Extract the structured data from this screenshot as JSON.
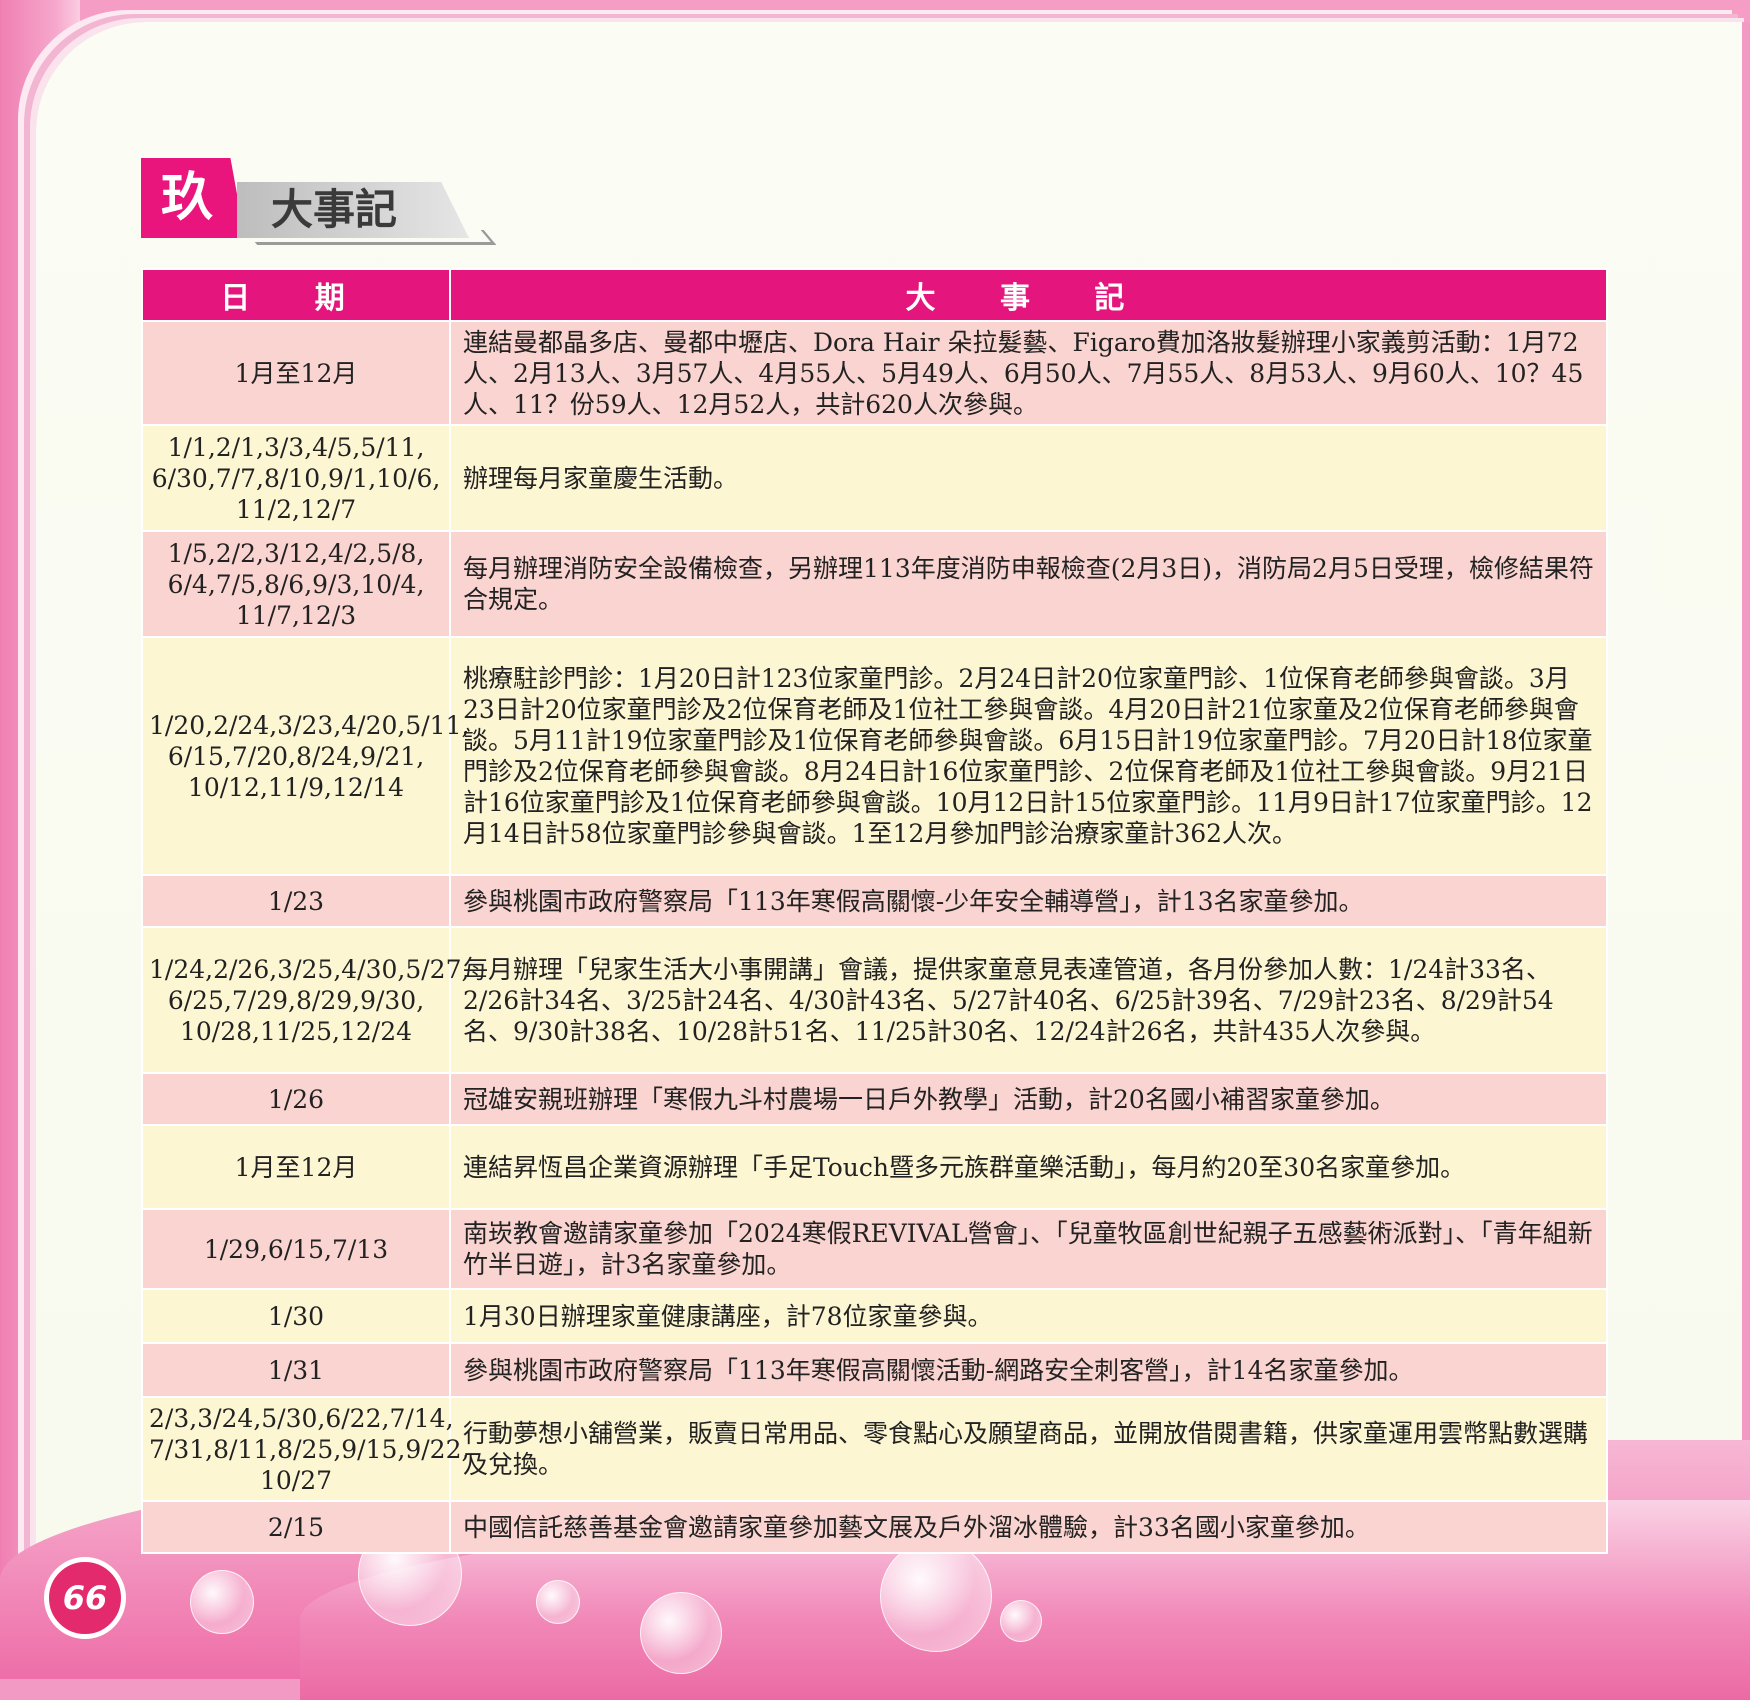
{
  "page_number": "66",
  "section": {
    "number": "玖",
    "title": "大事記"
  },
  "table": {
    "headers": [
      "日 期",
      "大 事 記"
    ],
    "rows": [
      {
        "date": "1月至12月",
        "event": "連結曼都晶多店、曼都中壢店、Dora Hair 朵拉髮藝、Figaro費加洛妝髮辦理小家義剪活動：1月72人、2月13人、3月57人、4月55人、5月49人、6月50人、7月55人、8月53人、9月60人、10？45人、11？份59人、12月52人，共計620人次參與。"
      },
      {
        "date": "1/1,2/1,3/3,4/5,5/11,\n6/30,7/7,8/10,9/1,10/6,\n11/2,12/7",
        "event": "辦理每月家童慶生活動。"
      },
      {
        "date": "1/5,2/2,3/12,4/2,5/8,\n6/4,7/5,8/6,9/3,10/4,\n11/7,12/3",
        "event": "每月辦理消防安全設備檢查，另辦理113年度消防申報檢查(2月3日)，消防局2月5日受理，檢修結果符合規定。"
      },
      {
        "date": "1/20,2/24,3/23,4/20,5/11,\n6/15,7/20,8/24,9/21,\n10/12,11/9,12/14",
        "event": "桃療駐診門診：1月20日計123位家童門診。2月24日計20位家童門診、1位保育老師參與會談。3月23日計20位家童門診及2位保育老師及1位社工參與會談。4月20日計21位家童及2位保育老師參與會談。5月11計19位家童門診及1位保育老師參與會談。6月15日計19位家童門診。7月20日計18位家童門診及2位保育老師參與會談。8月24日計16位家童門診、2位保育老師及1位社工參與會談。9月21日計16位家童門診及1位保育老師參與會談。10月12日計15位家童門診。11月9日計17位家童門診。12月14日計58位家童門診參與會談。1至12月參加門診治療家童計362人次。"
      },
      {
        "date": "1/23",
        "event": "參與桃園市政府警察局「113年寒假高關懷-少年安全輔導營」，計13名家童參加。"
      },
      {
        "date": "1/24,2/26,3/25,4/30,5/27,\n6/25,7/29,8/29,9/30,\n10/28,11/25,12/24",
        "event": "每月辦理「兒家生活大小事開講」會議，提供家童意見表達管道，各月份參加人數：1/24計33名、2/26計34名、3/25計24名、4/30計43名、5/27計40名、6/25計39名、7/29計23名、8/29計54名、9/30計38名、10/28計51名、11/25計30名、12/24計26名，共計435人次參與。"
      },
      {
        "date": "1/26",
        "event": "冠雄安親班辦理「寒假九斗村農場一日戶外教學」活動，計20名國小補習家童參加。"
      },
      {
        "date": "1月至12月",
        "event": "連結昇恆昌企業資源辦理「手足Touch暨多元族群童樂活動」，每月約20至30名家童參加。"
      },
      {
        "date": "1/29,6/15,7/13",
        "event": "南崁教會邀請家童參加「2024寒假REVIVAL營會」、「兒童牧區創世紀親子五感藝術派對」、「青年組新竹半日遊」，計3名家童參加。"
      },
      {
        "date": "1/30",
        "event": "1月30日辦理家童健康講座，計78位家童參與。"
      },
      {
        "date": "1/31",
        "event": "參與桃園市政府警察局「113年寒假高關懷活動-網路安全刺客營」，計14名家童參加。"
      },
      {
        "date": "2/3,3/24,5/30,6/22,7/14,\n7/31,8/11,8/25,9/15,9/22,\n10/27",
        "event": "行動夢想小舖營業，販賣日常用品、零食點心及願望商品，並開放借閱書籍，供家童運用雲幣點數選購及兌換。"
      },
      {
        "date": "2/15",
        "event": "中國信託慈善基金會邀請家童參加藝文展及戶外溜冰體驗，計33名國小家童參加。"
      }
    ]
  }
}
